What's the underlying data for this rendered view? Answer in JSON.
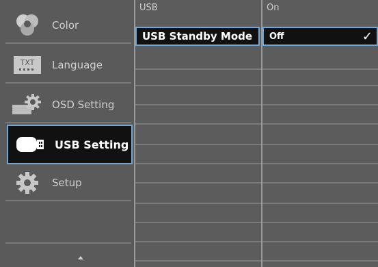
{
  "menu": {
    "items": [
      {
        "label": "Color",
        "icon": "color-icon"
      },
      {
        "label": "Language",
        "icon": "language-icon",
        "icon_text": "TXT"
      },
      {
        "label": "OSD Setting",
        "icon": "osd-setting-icon"
      },
      {
        "label": "USB Setting",
        "icon": "usb-icon",
        "selected": true
      },
      {
        "label": "Setup",
        "icon": "gear-icon"
      }
    ]
  },
  "submenu": {
    "header": "USB",
    "selected_item": "USB Standby Mode"
  },
  "options": {
    "header": "On",
    "selected_value": "Off",
    "check": "✓"
  },
  "colors": {
    "accent": "#6fa8d6",
    "background": "#5a5a5a",
    "selected_bg": "#111111"
  }
}
